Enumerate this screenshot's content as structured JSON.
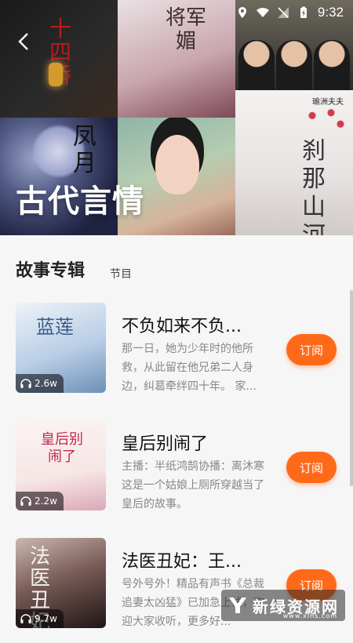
{
  "status_bar": {
    "time": "9:32"
  },
  "header": {
    "category_title": "古代言情"
  },
  "tabs": {
    "main": "故事专辑",
    "sub": "节目"
  },
  "albums": [
    {
      "title": "不负如来不负...",
      "description": "那一日，她为少年时的他所救，从此留在他兄弟二人身边，纠葛牵绊四十年。 家...",
      "plays": "2.6w",
      "subscribe_label": "订阅",
      "cover_text": "蓝莲"
    },
    {
      "title": "皇后别闹了",
      "description": "主播：半纸鸿鹄协播：离沐寒这是一个姑娘上厕所穿越当了皇后的故事。",
      "plays": "2.2w",
      "subscribe_label": "订阅",
      "cover_text": "皇后别闹了"
    },
    {
      "title": "法医丑妃：王...",
      "description": "号外号外！精品有声书《总裁追妻太凶猛》已加急上线，欢迎大家收听，更多好...",
      "plays": "9.7w",
      "subscribe_label": "订阅",
      "cover_text": "法医丑妃"
    }
  ],
  "cover_texts": {
    "tile1": "十四桥",
    "tile2": "将军媚",
    "tile4": "凤月",
    "tile6": "刹那山河",
    "tile6_top": "瑜洲夫夫"
  },
  "watermark": {
    "text": "新绿资源网",
    "url": "www.xlhs.com"
  },
  "colors": {
    "accent": "#ff6a1a",
    "title_text": "#111111",
    "desc_text": "#888888"
  }
}
